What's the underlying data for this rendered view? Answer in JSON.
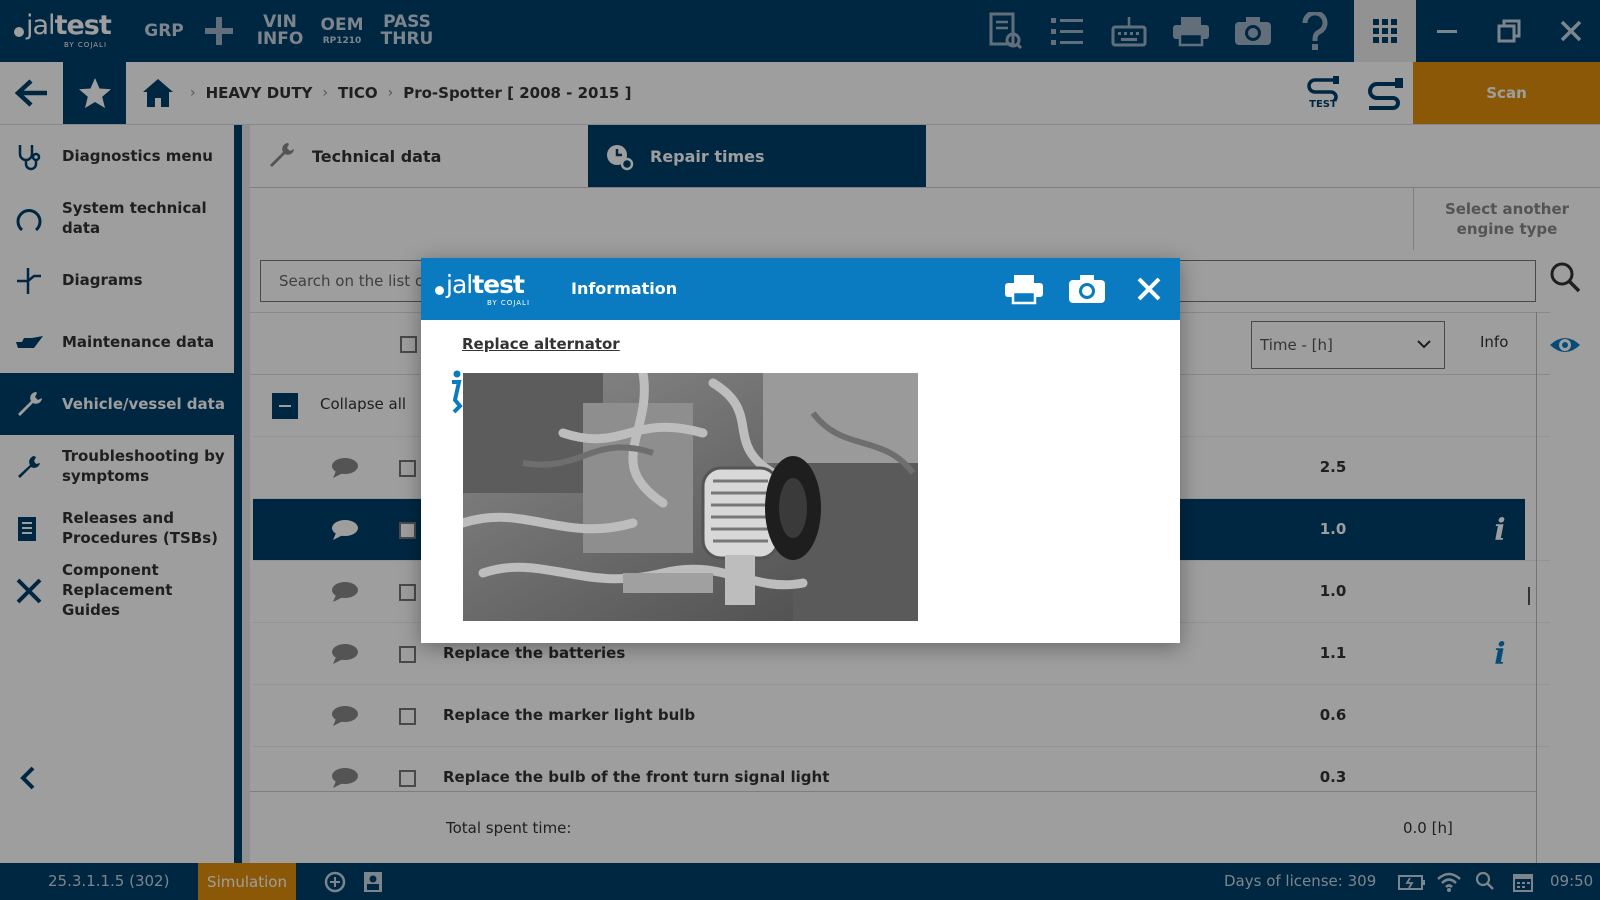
{
  "brand": {
    "name_light": "jal",
    "name_bold": "test",
    "by": "BY COJALI"
  },
  "topbar": {
    "grp": "GRP",
    "vin_l1": "VIN",
    "vin_l2": "INFO",
    "oem_l1": "OEM",
    "oem_l2": "RP1210",
    "pass_l1": "PASS",
    "pass_l2": "THRU"
  },
  "nav": {
    "breadcrumb": [
      "HEAVY DUTY",
      "TICO",
      "Pro-Spotter [ 2008 - 2015 ]"
    ],
    "scan_label": "Scan",
    "test_label": "TEST"
  },
  "sidebar": {
    "items": [
      {
        "label": "Diagnostics menu",
        "icon": "stethoscope-icon"
      },
      {
        "label": "System technical data",
        "icon": "horseshoe-icon"
      },
      {
        "label": "Diagrams",
        "icon": "diagram-icon"
      },
      {
        "label": "Maintenance data",
        "icon": "oil-can-icon"
      },
      {
        "label": "Vehicle/vessel data",
        "icon": "wrench-screwdriver-icon"
      },
      {
        "label": "Troubleshooting by symptoms",
        "icon": "troubleshooting-icon"
      },
      {
        "label": "Releases and Procedures (TSBs)",
        "icon": "document-icon"
      },
      {
        "label": "Component Replacement Guides",
        "icon": "tools-icon"
      }
    ],
    "active_index": 4
  },
  "tabs": [
    {
      "label": "Technical data",
      "icon": "wrench-icon"
    },
    {
      "label": "Repair times",
      "icon": "clock-gear-icon"
    }
  ],
  "engine_select": "Select another engine type",
  "search": {
    "placeholder": "Search on the list of"
  },
  "filter": {
    "time_select": "Time - [h]",
    "info_header": "Info"
  },
  "collapse_label": "Collapse all",
  "rows": [
    {
      "desc": "",
      "value": "2.5",
      "info": false
    },
    {
      "desc": "",
      "value": "1.0",
      "info": true
    },
    {
      "desc": "",
      "value": "1.0",
      "info": false
    },
    {
      "desc": "Replace the batteries",
      "value": "1.1",
      "info": true
    },
    {
      "desc": "Replace the marker light bulb",
      "value": "0.6",
      "info": false
    },
    {
      "desc": "Replace the bulb of the front turn signal light",
      "value": "0.3",
      "info": false
    }
  ],
  "selected_row": 1,
  "total": {
    "label": "Total spent time:",
    "value": "0.0 [h]"
  },
  "status": {
    "version": "25.3.1.1.5 (302)",
    "simulation": "Simulation",
    "license": "Days of license: 309",
    "clock": "09:50"
  },
  "modal": {
    "title": "Information",
    "subtitle": "Replace alternator",
    "image_icon": "alternator-photo"
  },
  "colors": {
    "navy": "#003f6b",
    "blue": "#0a7bc1",
    "orange": "#e08f0e"
  }
}
